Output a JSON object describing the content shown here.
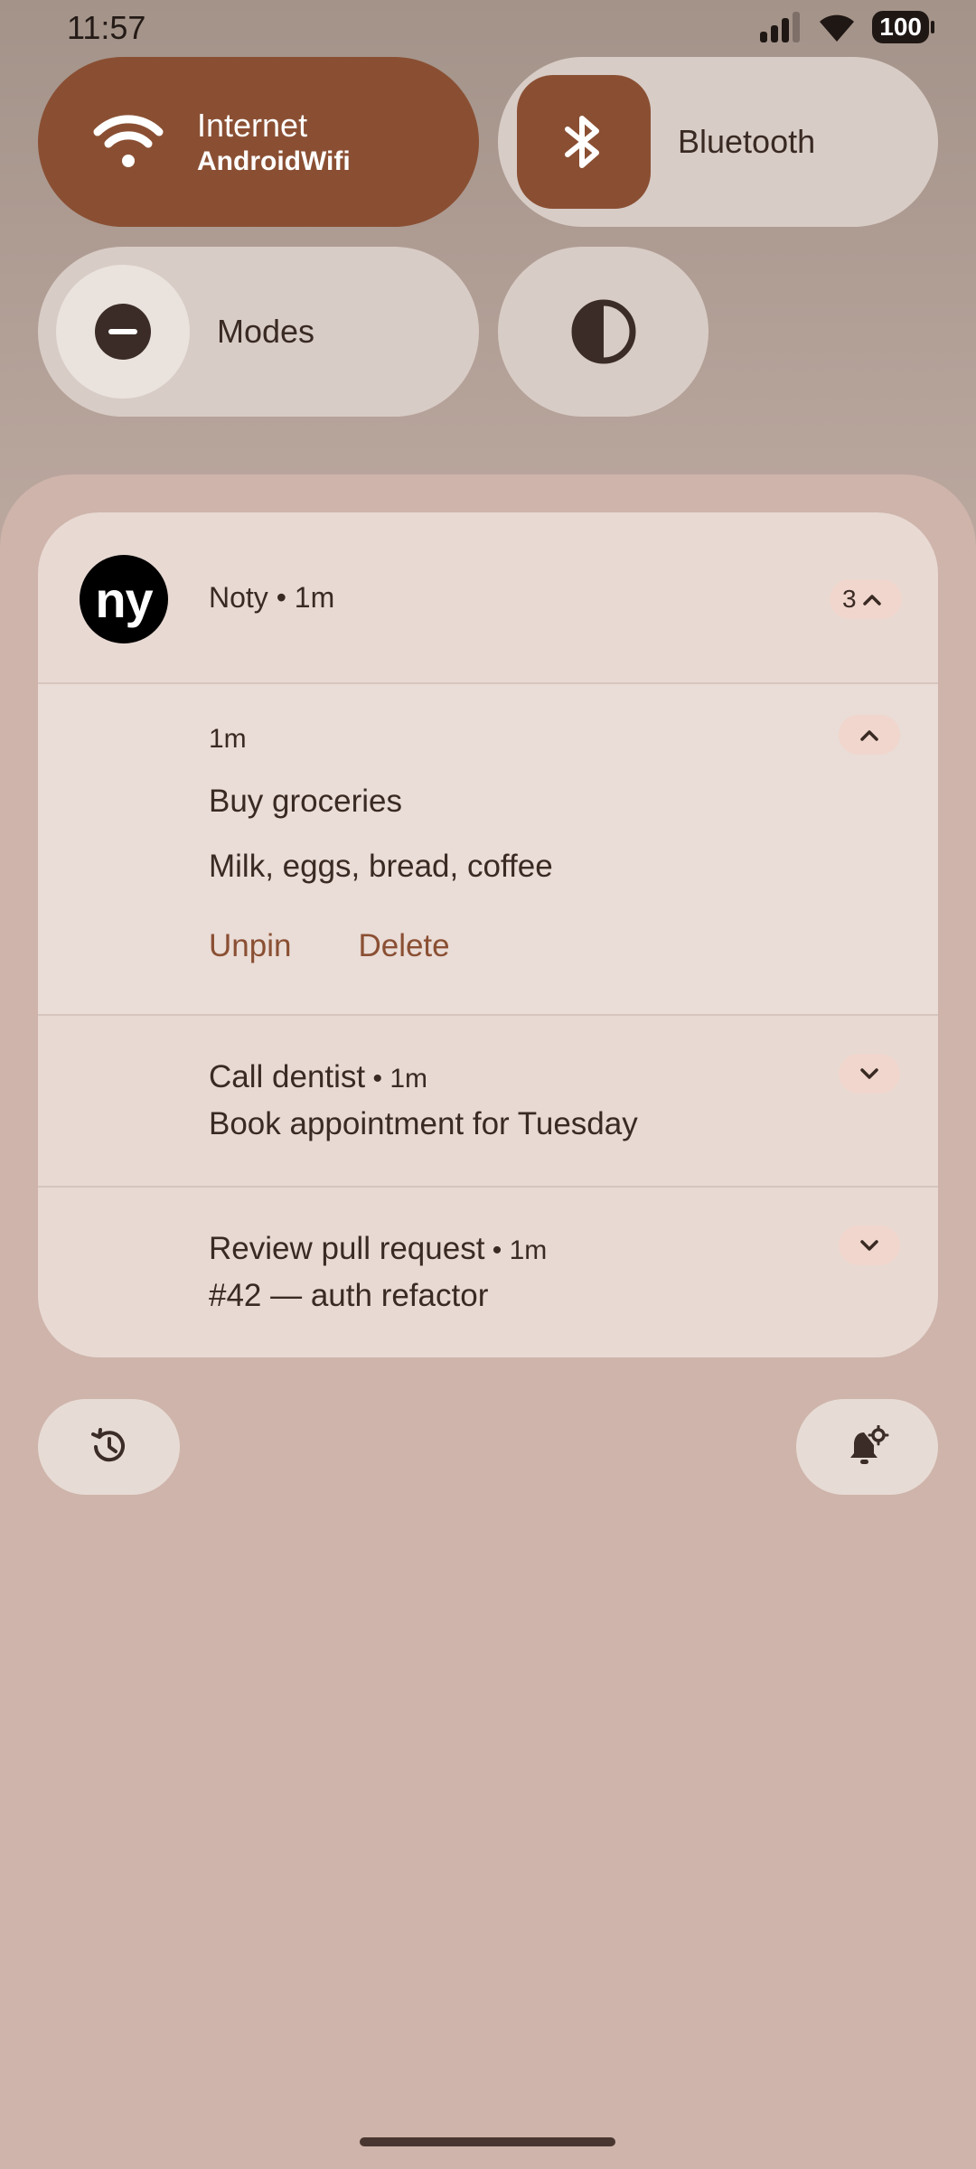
{
  "status_bar": {
    "time": "11:57",
    "battery": "100"
  },
  "quick_settings": {
    "internet": {
      "title": "Internet",
      "subtitle": "AndroidWifi"
    },
    "bluetooth": {
      "title": "Bluetooth"
    },
    "modes": {
      "title": "Modes"
    },
    "contrast": {
      "icon": "contrast-icon"
    }
  },
  "notification_group": {
    "app_icon_text": "ny",
    "header": "Noty • 1m",
    "count": "3",
    "expanded": {
      "time": "1m",
      "title": "Buy groceries",
      "body": "Milk, eggs, bread, coffee",
      "actions": [
        "Unpin",
        "Delete"
      ]
    },
    "items": [
      {
        "title": "Call dentist",
        "time": " • 1m",
        "body": "Book appointment for Tuesday"
      },
      {
        "title": "Review pull request",
        "time": " • 1m",
        "body": "#42 — auth refactor"
      }
    ]
  },
  "bottom_buttons": {
    "history": "history-icon",
    "settings": "notification-settings-icon"
  },
  "colors": {
    "accent": "#8a4f33",
    "tile": "#d8ccc6",
    "card": "#e8d9d3"
  }
}
